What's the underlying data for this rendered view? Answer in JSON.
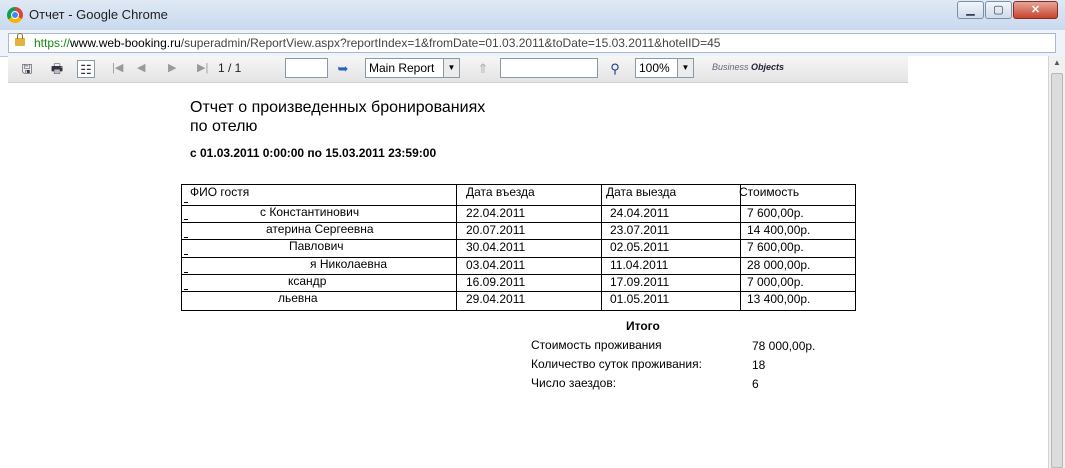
{
  "window": {
    "title": "Отчет - Google Chrome"
  },
  "address": {
    "protocol": "https://",
    "host": "www.web-booking.ru",
    "path": "/superadmin/ReportView.aspx?reportIndex=1&fromDate=01.03.2011&toDate=15.03.2011&hotelID=45"
  },
  "toolbar": {
    "page_indicator": "1 / 1",
    "report_select": "Main Report",
    "zoom": "100%",
    "logo_text_a": "Business",
    "logo_text_b": "Objects"
  },
  "report": {
    "title_line1": "Отчет о произведенных бронированиях",
    "title_line2": "по отелю",
    "period": "с 01.03.2011   0:00:00 по 15.03.2011  23:59:00",
    "columns": [
      "ФИО гостя",
      "Дата въезда",
      "Дата выезда",
      "Стоимость"
    ],
    "rows": [
      {
        "name": "с Константинович",
        "checkin": "22.04.2011",
        "checkout": "24.04.2011",
        "cost": "7 600,00р."
      },
      {
        "name": "атерина Сергеевна",
        "checkin": "20.07.2011",
        "checkout": "23.07.2011",
        "cost": "14 400,00р."
      },
      {
        "name": "Павлович",
        "checkin": "30.04.2011",
        "checkout": "02.05.2011",
        "cost": "7 600,00р."
      },
      {
        "name": "я Николаевна",
        "checkin": "03.04.2011",
        "checkout": "11.04.2011",
        "cost": "28 000,00р."
      },
      {
        "name": "ксандр",
        "checkin": "16.09.2011",
        "checkout": "17.09.2011",
        "cost": "7 000,00р."
      },
      {
        "name": "льевна",
        "checkin": "29.04.2011",
        "checkout": "01.05.2011",
        "cost": "13 400,00р."
      }
    ],
    "summary": {
      "heading": "Итого",
      "items": [
        {
          "label": "Стоимость проживания",
          "value": "78 000,00р."
        },
        {
          "label": "Количество суток проживания:",
          "value": "18"
        },
        {
          "label": "Число заездов:",
          "value": "6"
        }
      ]
    }
  }
}
